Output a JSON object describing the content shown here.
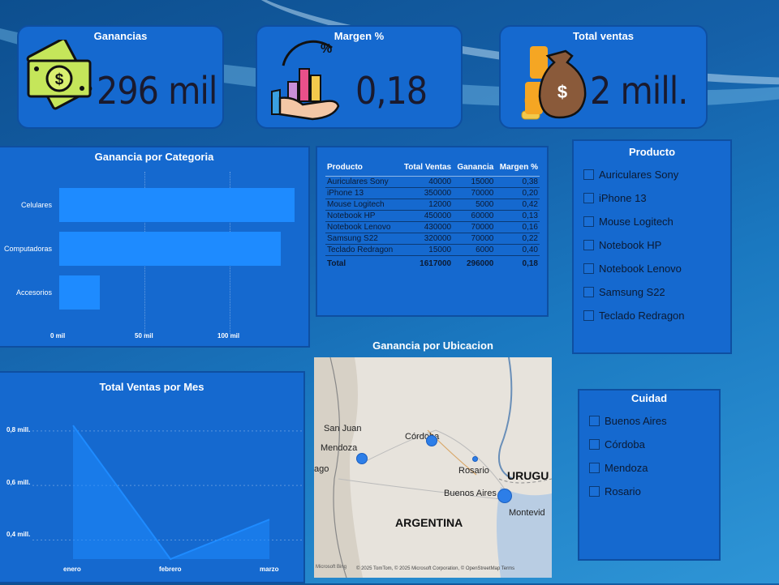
{
  "kpis": {
    "ganancias": {
      "title": "Ganancias",
      "value": "296 mil"
    },
    "margen": {
      "title": "Margen %",
      "value": "0,18"
    },
    "ventas": {
      "title": "Total ventas",
      "value": "2 mill."
    }
  },
  "ganancia_categoria": {
    "title": "Ganancia por Categoria",
    "categories": [
      "Celulares",
      "Computadoras",
      "Accesorios"
    ],
    "values": [
      150000,
      141000,
      26000
    ],
    "xticks": [
      "0 mil",
      "50 mil",
      "100 mil"
    ],
    "chart_data": {
      "type": "bar",
      "categories": [
        "Celulares",
        "Computadoras",
        "Accesorios"
      ],
      "values": [
        150000,
        141000,
        26000
      ],
      "title": "Ganancia por Categoria",
      "xlim": [
        0,
        155000
      ]
    }
  },
  "tabla": {
    "headers": [
      "Producto",
      "Total Ventas",
      "Ganancia",
      "Margen %"
    ],
    "rows": [
      [
        "Auriculares Sony",
        "40000",
        "15000",
        "0,38"
      ],
      [
        "iPhone 13",
        "350000",
        "70000",
        "0,20"
      ],
      [
        "Mouse Logitech",
        "12000",
        "5000",
        "0,42"
      ],
      [
        "Notebook HP",
        "450000",
        "60000",
        "0,13"
      ],
      [
        "Notebook Lenovo",
        "430000",
        "70000",
        "0,16"
      ],
      [
        "Samsung S22",
        "320000",
        "70000",
        "0,22"
      ],
      [
        "Teclado Redragon",
        "15000",
        "6000",
        "0,40"
      ]
    ],
    "total": [
      "Total",
      "1617000",
      "296000",
      "0,18"
    ]
  },
  "slicer_producto": {
    "title": "Producto",
    "items": [
      "Auriculares Sony",
      "iPhone 13",
      "Mouse Logitech",
      "Notebook HP",
      "Notebook Lenovo",
      "Samsung S22",
      "Teclado Redragon"
    ]
  },
  "slicer_ciudad": {
    "title": "Cuidad",
    "items": [
      "Buenos Aires",
      "Córdoba",
      "Mendoza",
      "Rosario"
    ]
  },
  "ventas_mes": {
    "title": "Total Ventas por Mes",
    "months": [
      "enero",
      "febrero",
      "marzo"
    ],
    "yticks": [
      "0,8 mill.",
      "0,6 mill.",
      "0,4 mill."
    ],
    "chart_data": {
      "type": "area",
      "categories": [
        "enero",
        "febrero",
        "marzo"
      ],
      "values": [
        820000,
        330000,
        475000
      ],
      "title": "Total Ventas por Mes",
      "ylim": [
        0.33,
        0.85
      ]
    }
  },
  "mapa": {
    "title": "Ganancia por Ubicacion",
    "labels": [
      "San Juan",
      "Mendoza",
      "Córdoba",
      "Rosario",
      "Buenos Aires",
      "URUGU",
      "Montevid",
      "ARGENTINA",
      "ago"
    ],
    "attribution": "© 2025 TomTom, © 2025 Microsoft Corporation, © OpenStreetMap Terms",
    "brand": "Microsoft Bing"
  },
  "colors": {
    "panel": "#1569cf",
    "bar": "#1e8bff",
    "dark_text": "#1a1a2e"
  }
}
